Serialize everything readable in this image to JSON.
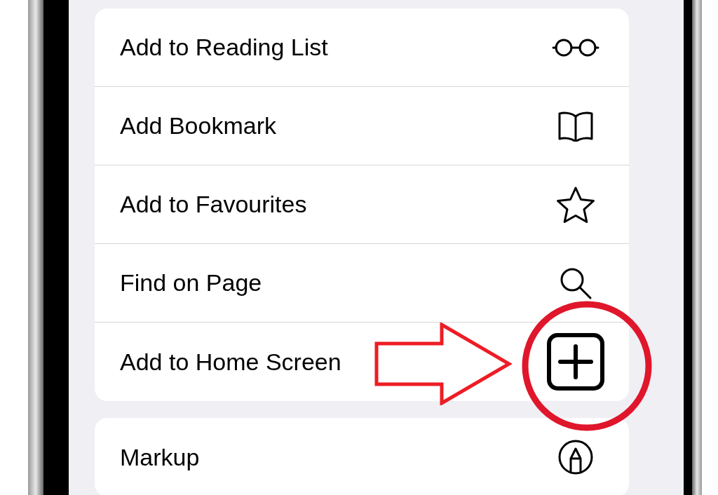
{
  "menu_groups": [
    {
      "items": [
        {
          "label": "Add to Reading List",
          "kind": "glasses"
        },
        {
          "label": "Add Bookmark",
          "kind": "book"
        },
        {
          "label": "Add to Favourites",
          "kind": "star"
        },
        {
          "label": "Find on Page",
          "kind": "search"
        },
        {
          "label": "Add to Home Screen",
          "kind": "plus-square"
        }
      ]
    },
    {
      "items": [
        {
          "label": "Markup",
          "kind": "pen"
        }
      ]
    }
  ]
}
